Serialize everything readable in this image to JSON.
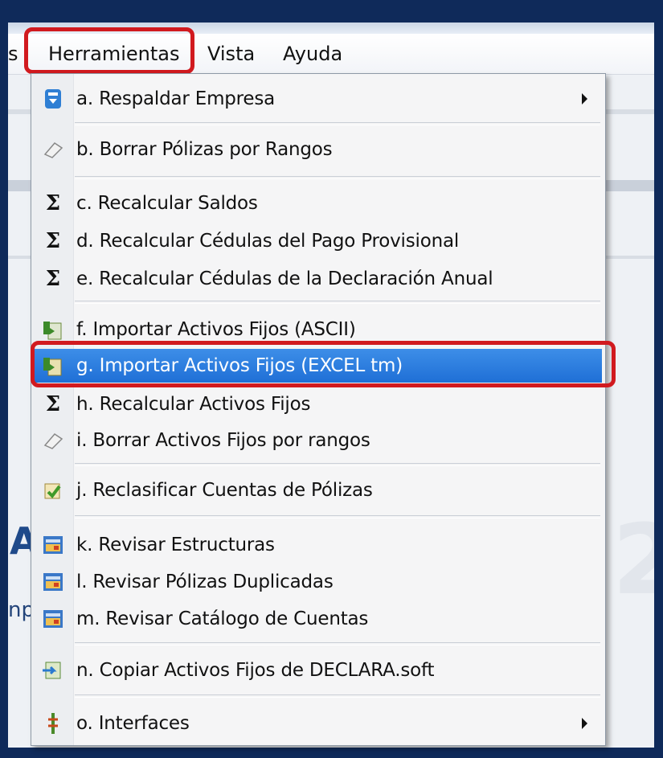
{
  "menubar": {
    "partial_left": "s",
    "herramientas": "Herramientas",
    "vista": "Vista",
    "ayuda": "Ayuda"
  },
  "background": {
    "left_fragment_a": "A",
    "left_fragment_b": "np",
    "right_fragment": "2"
  },
  "menu": {
    "items": [
      {
        "label": "a. Respaldar Empresa",
        "icon": "backup-icon",
        "submenu": true
      },
      {
        "label": "b. Borrar Pólizas por Rangos",
        "icon": "eraser-icon"
      },
      {
        "label": "c. Recalcular Saldos",
        "icon": "sigma-icon",
        "glyph": "Σ"
      },
      {
        "label": "d. Recalcular Cédulas del Pago Provisional",
        "icon": "sigma-icon",
        "glyph": "Σ"
      },
      {
        "label": "e. Recalcular Cédulas de la Declaración Anual",
        "icon": "sigma-icon",
        "glyph": "Σ"
      },
      {
        "label": "f. Importar Activos Fijos (ASCII)",
        "icon": "import-icon"
      },
      {
        "label": "g. Importar Activos Fijos (EXCEL tm)",
        "icon": "import-excel-icon",
        "selected": true
      },
      {
        "label": "h. Recalcular Activos Fijos",
        "icon": "sigma-icon",
        "glyph": "Σ"
      },
      {
        "label": "i. Borrar Activos Fijos por rangos",
        "icon": "eraser-icon"
      },
      {
        "label": "j. Reclasificar Cuentas de Pólizas",
        "icon": "reclassify-icon"
      },
      {
        "label": "k. Revisar Estructuras",
        "icon": "review-icon"
      },
      {
        "label": "l. Revisar Pólizas Duplicadas",
        "icon": "review-icon"
      },
      {
        "label": "m. Revisar Catálogo de Cuentas",
        "icon": "review-icon"
      },
      {
        "label": "n. Copiar Activos Fijos de DECLARA.soft",
        "icon": "copy-icon"
      },
      {
        "label": "o. Interfaces",
        "icon": "interfaces-icon",
        "submenu": true
      }
    ]
  },
  "colors": {
    "highlight": "#d11a1f",
    "selection": "#2a7ee0",
    "frame": "#0f2a5a"
  }
}
